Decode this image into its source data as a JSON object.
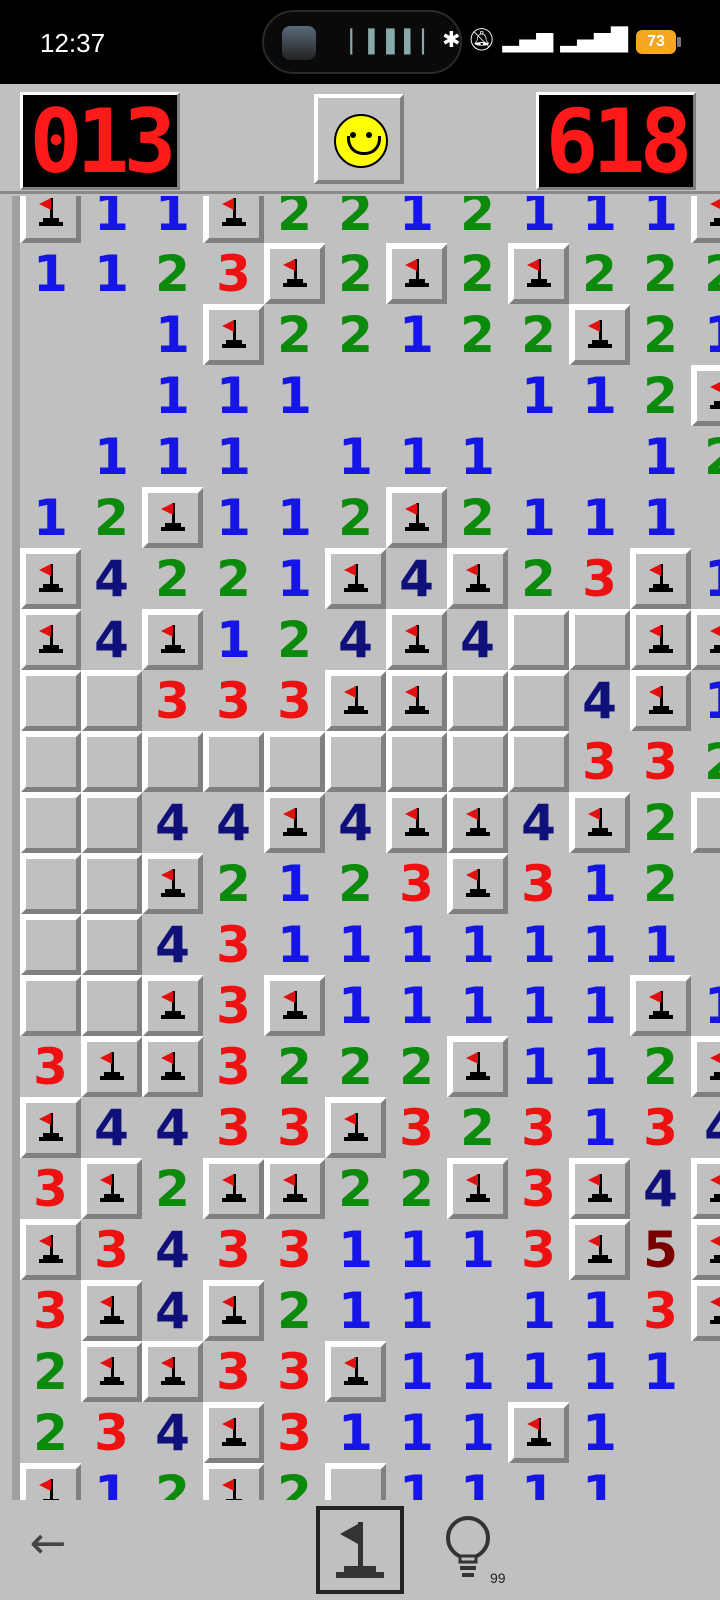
{
  "status_bar": {
    "time": "12:37",
    "icons": [
      "bluetooth-icon",
      "silent-icon",
      "signal-icon",
      "5g-signal-icon"
    ],
    "battery": "73",
    "battery_color": "#f5a623"
  },
  "header": {
    "mine_counter": "013",
    "timer": "618"
  },
  "bottom_bar": {
    "hint_count": "99"
  },
  "board": {
    "columns_visible": 12,
    "legend": "F = flag, C = closed, . = opened empty, digits = adjacent mine count",
    "rows": [
      [
        "F",
        "1",
        "1",
        "F",
        "2",
        "2",
        "1",
        "2",
        "1",
        "1",
        "1",
        "F"
      ],
      [
        "1",
        "1",
        "2",
        "3",
        "F",
        "2",
        "F",
        "2",
        "F",
        "2",
        "2",
        "2"
      ],
      [
        ".",
        ".",
        "1",
        "F",
        "2",
        "2",
        "1",
        "2",
        "2",
        "F",
        "2",
        "1"
      ],
      [
        ".",
        ".",
        "1",
        "1",
        "1",
        ".",
        ".",
        ".",
        "1",
        "1",
        "2",
        "F"
      ],
      [
        ".",
        "1",
        "1",
        "1",
        ".",
        "1",
        "1",
        "1",
        ".",
        ".",
        "1",
        "2"
      ],
      [
        "1",
        "2",
        "F",
        "1",
        "1",
        "2",
        "F",
        "2",
        "1",
        "1",
        "1",
        "."
      ],
      [
        "F",
        "4",
        "2",
        "2",
        "1",
        "F",
        "4",
        "F",
        "2",
        "3",
        "F",
        "1"
      ],
      [
        "F",
        "4",
        "F",
        "1",
        "2",
        "4",
        "F",
        "4",
        "C",
        "C",
        "F",
        "F"
      ],
      [
        "C",
        "C",
        "3",
        "3",
        "3",
        "F",
        "F",
        "C",
        "C",
        "4",
        "F",
        "1"
      ],
      [
        "C",
        "C",
        "C",
        "C",
        "C",
        "C",
        "C",
        "C",
        "C",
        "3",
        "3",
        "2"
      ],
      [
        "C",
        "C",
        "4",
        "4",
        "F",
        "4",
        "F",
        "F",
        "4",
        "F",
        "2",
        "C"
      ],
      [
        "C",
        "C",
        "F",
        "2",
        "1",
        "2",
        "3",
        "F",
        "3",
        "1",
        "2",
        "."
      ],
      [
        "C",
        "C",
        "4",
        "3",
        "1",
        "1",
        "1",
        "1",
        "1",
        "1",
        "1",
        "."
      ],
      [
        "C",
        "C",
        "F",
        "3",
        "F",
        "1",
        "1",
        "1",
        "1",
        "1",
        "F",
        "1"
      ],
      [
        "3",
        "F",
        "F",
        "3",
        "2",
        "2",
        "2",
        "F",
        "1",
        "1",
        "2",
        "F"
      ],
      [
        "F",
        "4",
        "4",
        "3",
        "3",
        "F",
        "3",
        "2",
        "3",
        "1",
        "3",
        "4"
      ],
      [
        "3",
        "F",
        "2",
        "F",
        "F",
        "2",
        "2",
        "F",
        "3",
        "F",
        "4",
        "F"
      ],
      [
        "F",
        "3",
        "4",
        "3",
        "3",
        "1",
        "1",
        "1",
        "3",
        "F",
        "5",
        "F"
      ],
      [
        "3",
        "F",
        "4",
        "F",
        "2",
        "1",
        "1",
        ".",
        "1",
        "1",
        "3",
        "F"
      ],
      [
        "2",
        "F",
        "F",
        "3",
        "3",
        "F",
        "1",
        "1",
        "1",
        "1",
        "1",
        "."
      ],
      [
        "2",
        "3",
        "4",
        "F",
        "3",
        "1",
        "1",
        "1",
        "F",
        "1",
        ".",
        "."
      ],
      [
        "F",
        "1",
        "2",
        "F",
        "2",
        "C",
        "1",
        "1",
        "1",
        "1",
        ".",
        "."
      ]
    ]
  }
}
